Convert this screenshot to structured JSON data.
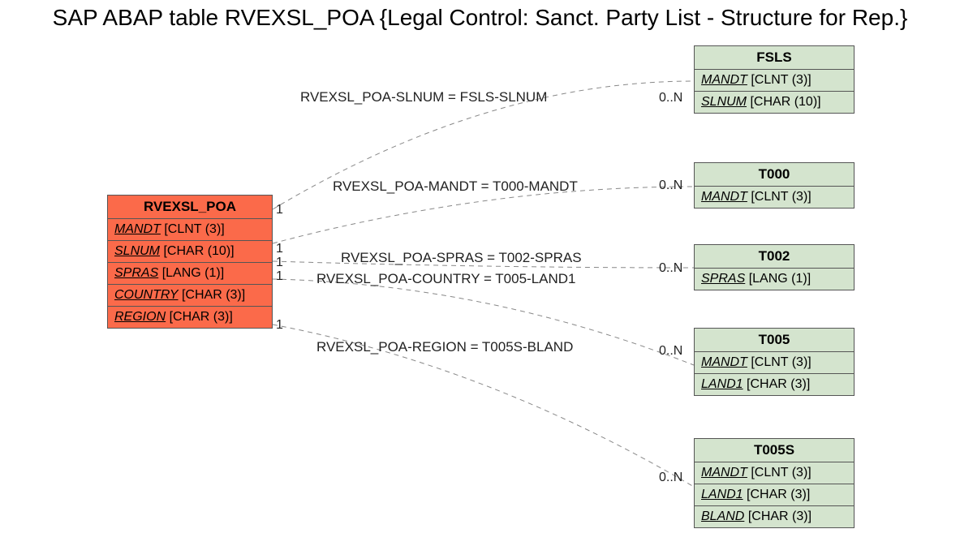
{
  "title": "SAP ABAP table RVEXSL_POA {Legal Control: Sanct. Party List - Structure for Rep.}",
  "main": {
    "name": "RVEXSL_POA",
    "fields": [
      {
        "name": "MANDT",
        "type": "[CLNT (3)]"
      },
      {
        "name": "SLNUM",
        "type": "[CHAR (10)]"
      },
      {
        "name": "SPRAS",
        "type": "[LANG (1)]"
      },
      {
        "name": "COUNTRY",
        "type": "[CHAR (3)]"
      },
      {
        "name": "REGION",
        "type": "[CHAR (3)]"
      }
    ]
  },
  "related": [
    {
      "name": "FSLS",
      "fields": [
        {
          "name": "MANDT",
          "type": "[CLNT (3)]"
        },
        {
          "name": "SLNUM",
          "type": "[CHAR (10)]"
        }
      ]
    },
    {
      "name": "T000",
      "fields": [
        {
          "name": "MANDT",
          "type": "[CLNT (3)]"
        }
      ]
    },
    {
      "name": "T002",
      "fields": [
        {
          "name": "SPRAS",
          "type": "[LANG (1)]"
        }
      ]
    },
    {
      "name": "T005",
      "fields": [
        {
          "name": "MANDT",
          "type": "[CLNT (3)]"
        },
        {
          "name": "LAND1",
          "type": "[CHAR (3)]"
        }
      ]
    },
    {
      "name": "T005S",
      "fields": [
        {
          "name": "MANDT",
          "type": "[CLNT (3)]"
        },
        {
          "name": "LAND1",
          "type": "[CHAR (3)]"
        },
        {
          "name": "BLAND",
          "type": "[CHAR (3)]"
        }
      ]
    }
  ],
  "relations": [
    {
      "label": "RVEXSL_POA-SLNUM = FSLS-SLNUM",
      "left_card": "1",
      "right_card": "0..N"
    },
    {
      "label": "RVEXSL_POA-MANDT = T000-MANDT",
      "left_card": "1",
      "right_card": "0..N"
    },
    {
      "label": "RVEXSL_POA-SPRAS = T002-SPRAS",
      "left_card": "1",
      "right_card": "0..N"
    },
    {
      "label": "RVEXSL_POA-COUNTRY = T005-LAND1",
      "left_card": "1",
      "right_card": "0..N"
    },
    {
      "label": "RVEXSL_POA-REGION = T005S-BLAND",
      "left_card": "1",
      "right_card": "0..N"
    }
  ]
}
